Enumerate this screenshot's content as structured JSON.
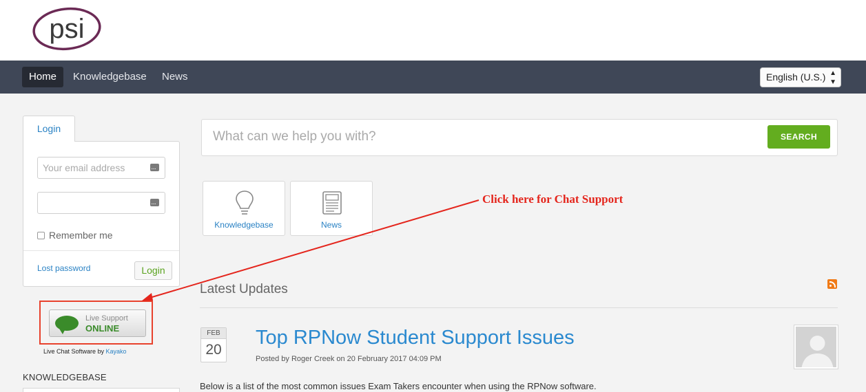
{
  "brand": {
    "logo_text": "psi"
  },
  "nav": {
    "items": [
      {
        "label": "Home",
        "active": true
      },
      {
        "label": "Knowledgebase",
        "active": false
      },
      {
        "label": "News",
        "active": false
      }
    ],
    "language": "English (U.S.)"
  },
  "login": {
    "tab_label": "Login",
    "email_placeholder": "Your email address",
    "password_placeholder": "",
    "remember_label": "Remember me",
    "lost_password": "Lost password",
    "login_button": "Login"
  },
  "live_support": {
    "line1": "Live Support",
    "line2": "ONLINE",
    "credit_prefix": "Live Chat Software by ",
    "credit_link": "Kayako"
  },
  "knowledgebase_heading": "KNOWLEDGEBASE",
  "search": {
    "placeholder": "What can we help you with?",
    "button": "SEARCH"
  },
  "tiles": [
    {
      "label": "Knowledgebase",
      "icon": "lightbulb-icon"
    },
    {
      "label": "News",
      "icon": "newspaper-icon"
    }
  ],
  "annotation": "Click here for Chat Support",
  "latest": {
    "heading": "Latest Updates",
    "article": {
      "month": "FEB",
      "day": "20",
      "title": "Top RPNow Student Support Issues",
      "meta": "Posted by Roger Creek on 20 February 2017 04:09 PM",
      "body": "Below is a list of the most common issues Exam Takers encounter when using the RPNow software."
    }
  },
  "colors": {
    "navbar": "#3f4757",
    "accent_blue": "#2a82c4",
    "search_green": "#63ad1f",
    "annotation_red": "#e4251c",
    "logo_purple": "#6b2a55"
  }
}
